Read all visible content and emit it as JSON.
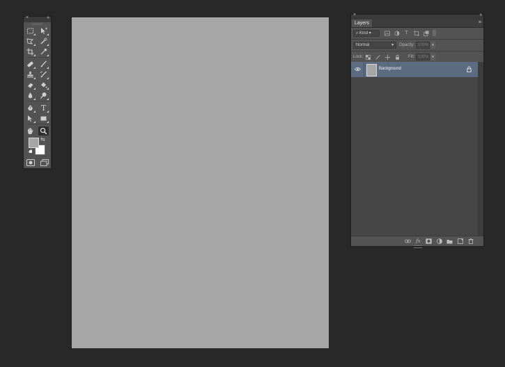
{
  "tools_panel": {
    "close_glyph": "×",
    "collapse_glyph": "››",
    "tools": [
      {
        "name": "rectangular-marquee-icon"
      },
      {
        "name": "move-icon"
      },
      {
        "name": "lasso-icon"
      },
      {
        "name": "quick-selection-icon"
      },
      {
        "name": "crop-icon"
      },
      {
        "name": "eyedropper-icon"
      },
      {
        "name": "spot-healing-icon"
      },
      {
        "name": "brush-icon"
      },
      {
        "name": "clone-stamp-icon"
      },
      {
        "name": "history-brush-icon"
      },
      {
        "name": "eraser-icon"
      },
      {
        "name": "paint-bucket-icon"
      },
      {
        "name": "blur-icon"
      },
      {
        "name": "dodge-icon"
      },
      {
        "name": "pen-icon"
      },
      {
        "name": "type-icon",
        "glyph": "T"
      },
      {
        "name": "path-selection-icon"
      },
      {
        "name": "rectangle-shape-icon"
      },
      {
        "name": "hand-icon"
      },
      {
        "name": "zoom-icon"
      }
    ],
    "selected_tool": "zoom-icon",
    "foreground_color": "#a6a6a6",
    "background_color": "#ffffff",
    "swap_glyph": "⇆"
  },
  "canvas": {
    "fill_color": "#a6a6a6"
  },
  "layers_panel": {
    "close_glyph": "×",
    "collapse_glyph": "››",
    "tab_label": "Layers",
    "menu_glyph": "≡",
    "filter_kind": "Kind",
    "filter_icons": [
      "image-filter-icon",
      "adjustment-filter-icon",
      "type-filter-icon",
      "shape-filter-icon",
      "smart-object-filter-icon"
    ],
    "type_filter_glyph": "T",
    "blend_mode": "Normal",
    "opacity_label": "Opacity:",
    "opacity_value": "100%",
    "lock_label": "Lock:",
    "fill_label": "Fill:",
    "fill_value": "100%",
    "lock_icons": [
      "lock-transparent-icon",
      "lock-image-icon",
      "lock-position-icon",
      "lock-all-icon"
    ],
    "layers": [
      {
        "name": "Background",
        "visible": true,
        "locked": true,
        "selected": true
      }
    ],
    "bottom_icons": [
      "link-layers-icon",
      "layer-style-icon",
      "layer-mask-icon",
      "adjustment-layer-icon",
      "group-folder-icon",
      "new-layer-icon",
      "delete-layer-icon"
    ],
    "fx_glyph": "fx"
  }
}
